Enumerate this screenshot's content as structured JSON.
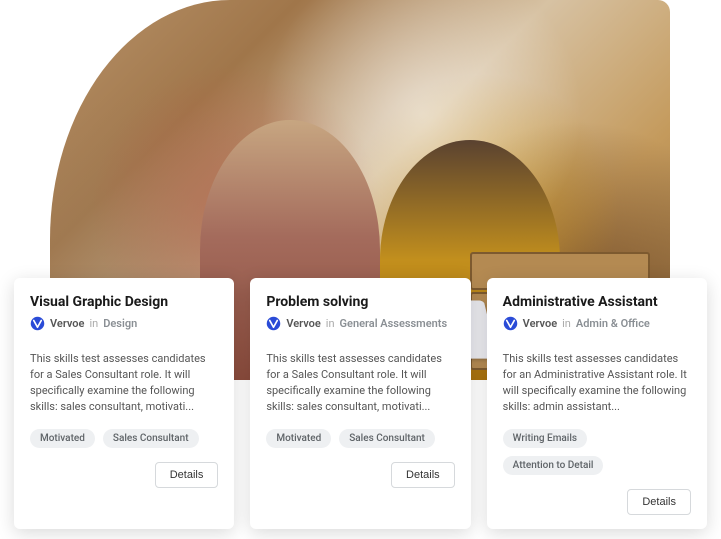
{
  "cards": [
    {
      "title": "Visual Graphic Design",
      "author": "Vervoe",
      "in": "in",
      "category": "Design",
      "description": "This skills test assesses candidates for a Sales Consultant role. It will specifically examine the following skills: sales consultant, motivati...",
      "tags": [
        "Motivated",
        "Sales Consultant"
      ],
      "details_label": "Details"
    },
    {
      "title": "Problem solving",
      "author": "Vervoe",
      "in": "in",
      "category": "General Assessments",
      "description": "This skills test assesses candidates for a Sales Consultant role. It will specifically examine the following skills: sales consultant, motivati...",
      "tags": [
        "Motivated",
        "Sales Consultant"
      ],
      "details_label": "Details"
    },
    {
      "title": "Administrative Assistant",
      "author": "Vervoe",
      "in": "in",
      "category": "Admin & Office",
      "description": "This skills test assesses candidates for an Administrative Assistant role. It will specifically examine the following skills: admin assistant...",
      "tags": [
        "Writing Emails",
        "Attention to Detail"
      ],
      "details_label": "Details"
    }
  ]
}
